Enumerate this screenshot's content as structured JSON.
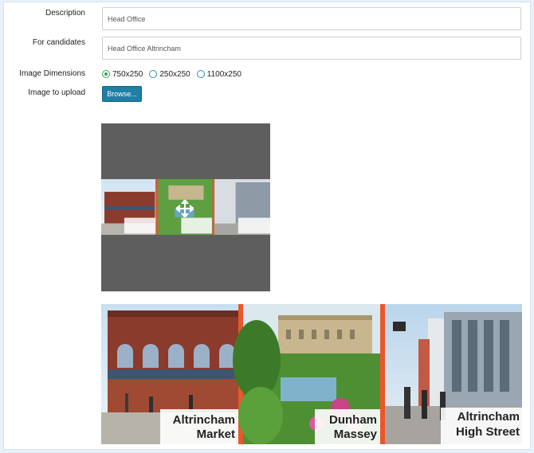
{
  "form": {
    "description": {
      "label": "Description",
      "value": "Head Office"
    },
    "candidates": {
      "label": "For candidates",
      "value": "Head Office Altrincham"
    },
    "dimensions": {
      "label": "Image Dimensions",
      "options": [
        "750x250",
        "250x250",
        "1100x250"
      ],
      "selected": "750x250"
    },
    "upload": {
      "label": "Image to upload",
      "button": "Browse..."
    }
  },
  "image": {
    "panels": [
      {
        "line1": "Altrincham",
        "line2": "Market"
      },
      {
        "line1": "Dunham",
        "line2": "Massey"
      },
      {
        "line1": "Altrincham",
        "line2": "High Street"
      }
    ]
  },
  "colors": {
    "accent_button": "#1f7fa5",
    "radio_selected": "#3aa157",
    "divider_orange": "#e9572b",
    "cropper_bg": "#5e5e5e"
  },
  "icons": {
    "move": "move-cross-icon"
  }
}
